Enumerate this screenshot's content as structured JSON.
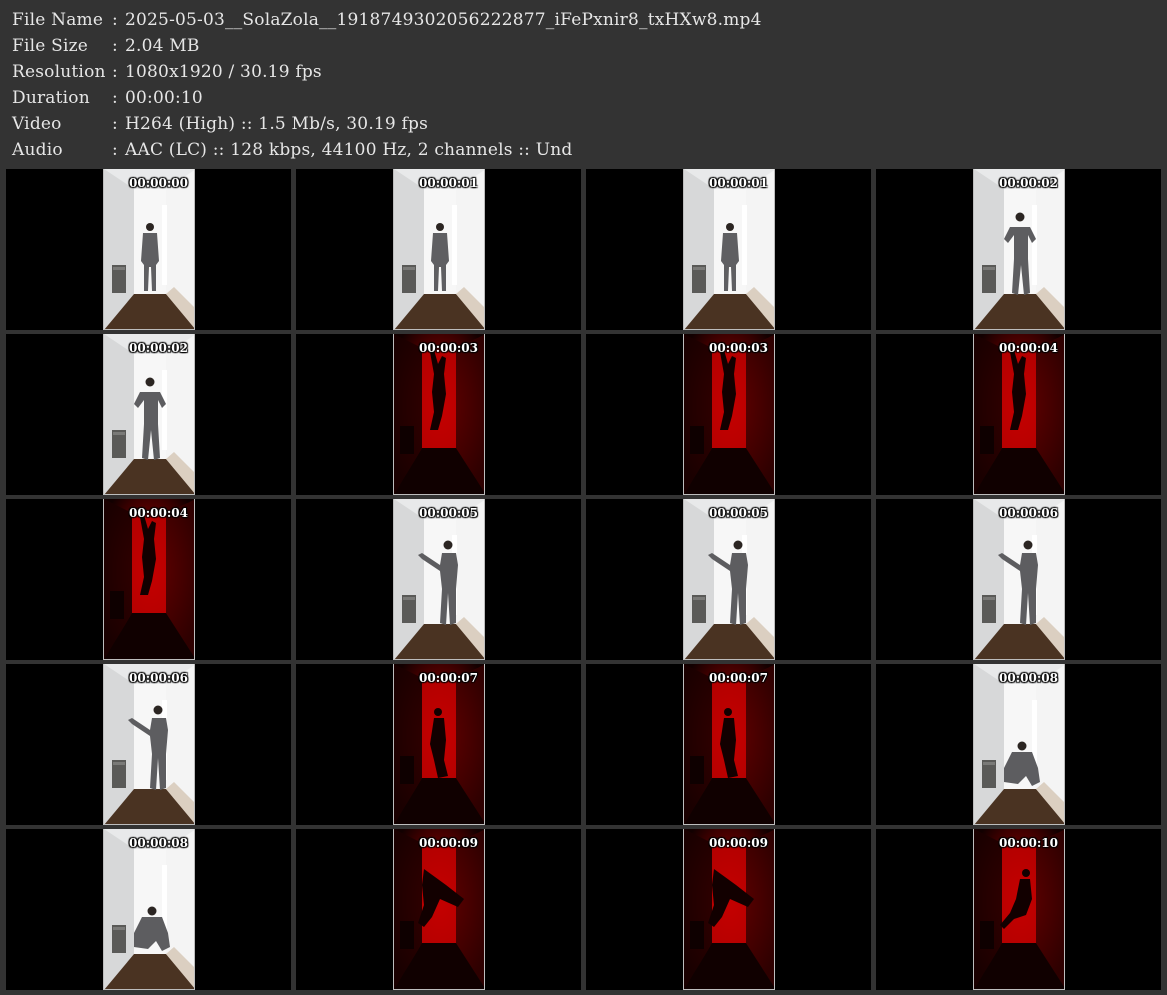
{
  "info": [
    {
      "label": "File Name",
      "value": "2025-05-03__SolaZola__1918749302056222877_iFePxnir8_txHXw8.mp4"
    },
    {
      "label": "File Size",
      "value": "2.04 MB"
    },
    {
      "label": "Resolution",
      "value": "1080x1920 / 30.19 fps"
    },
    {
      "label": "Duration",
      "value": "00:00:10"
    },
    {
      "label": "Video",
      "value": "H264 (High) :: 1.5 Mb/s, 30.19 fps"
    },
    {
      "label": "Audio",
      "value": "AAC (LC) :: 128 kbps, 44100 Hz, 2 channels :: Und"
    }
  ],
  "separator": ":",
  "thumbnails": [
    {
      "time": "00:00:00",
      "scene": "light-standing"
    },
    {
      "time": "00:00:01",
      "scene": "light-standing"
    },
    {
      "time": "00:00:01",
      "scene": "light-standing"
    },
    {
      "time": "00:00:02",
      "scene": "light-arms"
    },
    {
      "time": "00:00:02",
      "scene": "light-arms"
    },
    {
      "time": "00:00:03",
      "scene": "red-pose"
    },
    {
      "time": "00:00:03",
      "scene": "red-pose"
    },
    {
      "time": "00:00:04",
      "scene": "red-pose"
    },
    {
      "time": "00:00:04",
      "scene": "red-pose"
    },
    {
      "time": "00:00:05",
      "scene": "light-reach"
    },
    {
      "time": "00:00:05",
      "scene": "light-reach"
    },
    {
      "time": "00:00:06",
      "scene": "light-reach"
    },
    {
      "time": "00:00:06",
      "scene": "light-reach"
    },
    {
      "time": "00:00:07",
      "scene": "red-side"
    },
    {
      "time": "00:00:07",
      "scene": "red-side"
    },
    {
      "time": "00:00:08",
      "scene": "light-squat"
    },
    {
      "time": "00:00:08",
      "scene": "light-squat"
    },
    {
      "time": "00:00:09",
      "scene": "red-lean"
    },
    {
      "time": "00:00:09",
      "scene": "red-lean"
    },
    {
      "time": "00:00:10",
      "scene": "red-bend"
    }
  ],
  "colors": {
    "background": "#333333",
    "cell": "#000000",
    "text": "#e6e6e6",
    "red_scene": "#c40000"
  }
}
